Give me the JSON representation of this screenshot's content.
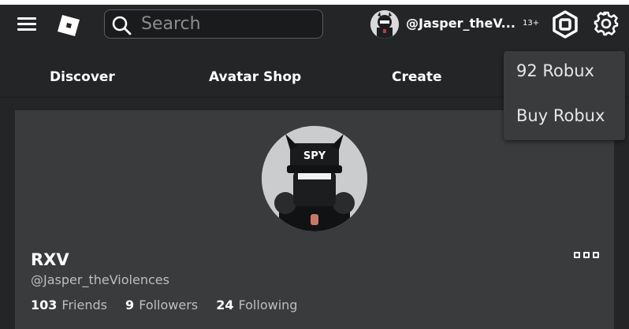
{
  "header": {
    "search_placeholder": "Search",
    "username": "@Jasper_theV...",
    "age_badge": "13+"
  },
  "nav": {
    "items": [
      {
        "label": "Discover"
      },
      {
        "label": "Avatar Shop"
      },
      {
        "label": "Create"
      }
    ]
  },
  "robux_menu": {
    "balance": "92 Robux",
    "buy": "Buy Robux"
  },
  "profile": {
    "display_name": "RXV",
    "handle": "@Jasper_theViolences",
    "stats": [
      {
        "value": "103",
        "label": "Friends"
      },
      {
        "value": "9",
        "label": "Followers"
      },
      {
        "value": "24",
        "label": "Following"
      }
    ],
    "avatar_hat_text": "SPY"
  },
  "colors": {
    "background": "#232527",
    "card": "#393b3d",
    "text_primary": "#ffffff",
    "text_secondary": "#bdbebe"
  },
  "icons": {
    "menu": "hamburger-icon",
    "logo": "roblox-logo-icon",
    "search": "search-icon",
    "robux": "robux-icon",
    "settings": "gear-icon",
    "more": "more-options-icon"
  }
}
